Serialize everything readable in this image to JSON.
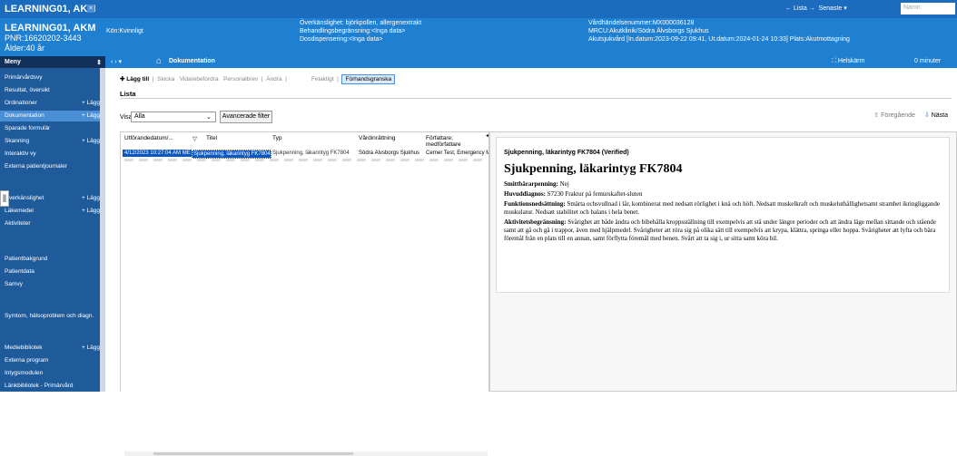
{
  "topbar": {
    "patient_name": "LEARNING01, AKM",
    "tab_close": "×",
    "nav_list": "← Lista →",
    "nav_recent": "Senaste ▾",
    "search_placeholder": "Namn"
  },
  "header": {
    "name": "LEARNING01, AKM",
    "pnr": "PNR:16620202-3443",
    "age": "Ålder:40 år",
    "gender": "Kön:Kvinnligt",
    "allergy": "Överkänslighet: björkpollen, allergenextrakt",
    "treatment_limit": "Behandlingsbegränsning:<Inga data>",
    "dose_limit": "Dosdispensering:<Inga data>",
    "episode": "Vårdhändelsenummer:MX000036128",
    "mrcu": "MRCU:Akutklinik/Södra Älvsborgs Sjukhus",
    "admission": "Akutsjukvård [In.datum:2023-09-22 09:41, Ut.datum:2024-01-24 10:33] Plats:Akutmottagning"
  },
  "toolbar2": {
    "nav_arrows": "‹  ›  ▾",
    "home_icon": "⌂",
    "title": "Dokumentation",
    "fullscreen": "⛶ Helskärm",
    "timer": "0 minuter"
  },
  "menu": {
    "title": "Meny",
    "pin": "⇕"
  },
  "sidebar": {
    "items": [
      {
        "label": "Primärvårdsvy",
        "add": ""
      },
      {
        "label": "Resultat, översikt",
        "add": ""
      },
      {
        "label": "Ordinationer",
        "add": "+ Lägg"
      },
      {
        "label": "Dokumentation",
        "add": "+ Lägg"
      },
      {
        "label": "Sparade formulär",
        "add": ""
      },
      {
        "label": "Skanning",
        "add": "+ Lägg"
      },
      {
        "label": "Interaktiv vy",
        "add": ""
      },
      {
        "label": "Externa patientjournaler",
        "add": ""
      },
      {
        "label": "Överkänslighet",
        "add": "+ Lägg"
      },
      {
        "label": "Läkemedel",
        "add": "+ Lägg"
      },
      {
        "label": "Aktiviteter",
        "add": ""
      },
      {
        "label": "Patientbakgrund",
        "add": ""
      },
      {
        "label": "Patientdata",
        "add": ""
      },
      {
        "label": "Samvy",
        "add": ""
      },
      {
        "label": "Symtom, hälsoproblem och diagn.",
        "add": ""
      },
      {
        "label": "Mediebibliotek",
        "add": "+ Lägg"
      },
      {
        "label": "Externa program",
        "add": ""
      },
      {
        "label": "Intygsmodulen",
        "add": ""
      },
      {
        "label": "Länkbibliotek - Primärvård",
        "add": ""
      }
    ]
  },
  "actions": {
    "add": "Lägg till",
    "send": "Skicka",
    "forward": "Vidarebefordra",
    "letter": "Personalbrev",
    "change": "Ändra",
    "error": "Felaktigt",
    "preview": "Förhandsgranska"
  },
  "list_label": "Lista",
  "filter": {
    "label": "Visa:",
    "selected": "Alla",
    "advanced": "Avancerade filter"
  },
  "nav": {
    "prev": "Föregående",
    "next": "Nästa"
  },
  "grid": {
    "columns": [
      "Utförandedatum/...",
      "Titel",
      "Typ",
      "Vårdinrättning",
      "Författare; medförfattare"
    ],
    "row": [
      "4/12/2023 10:27:04 AM ME",
      "Sjukpenning, läkarintyg FK7804",
      "Sjukpenning, läkarintyg FK7804",
      "Södra Älvsborgs Sjukhus",
      "Cerner Test, Emergency Medicin"
    ]
  },
  "doc": {
    "verified_title": "Sjukpenning, läkarintyg FK7804 (Verified)",
    "heading": "Sjukpenning, läkarintyg FK7804",
    "smitt_label": "Smittbärarpenning:",
    "smitt_value": "Nej",
    "diag_label": "Huvuddiagnos:",
    "diag_value": "S7230 Fraktur på femurskaftet-sluten",
    "func_label": "Funktionsnedsättning:",
    "func_value": "Smärta ochsvullnad i lår, kombinerat med nedsatt rörlighet i knä och höft. Nedsatt muskelkraft och muskeluthållighetsamt stramhet ikringliggande muskulatur. Nedsatt stabilitet och balans i hela benet.",
    "act_label": "Aktivitetsbegränsning:",
    "act_value": "Svårighet att både ändra och bibehålla kroppsställning till exempelvis att stå under längre perioder och att ändra läge mellan sittande och stående samt att gå och gå i trappor, även med hjälpmedel. Svårigheter att röra sig på olika sätt till exempelvis att krypa, klättra, springa eller hoppa. Svårigheter att lyfta och bära föremål från en plats till en annan, samt förflytta föremål med benen. Svårt att ta sig i, ur sitta samt köra bil."
  }
}
